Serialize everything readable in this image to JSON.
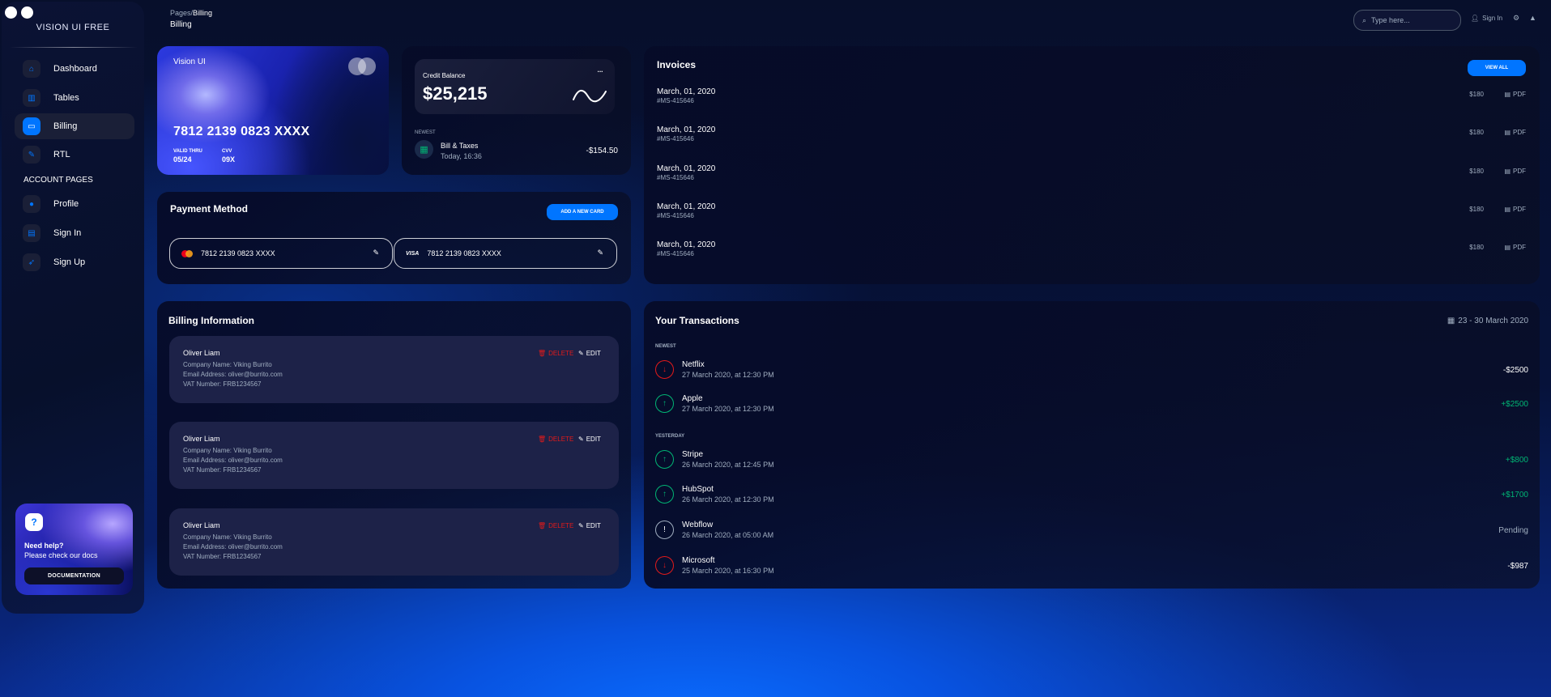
{
  "brand": "VISION UI FREE",
  "nav": [
    {
      "label": "Dashboard",
      "icon": "home-icon"
    },
    {
      "label": "Tables",
      "icon": "chart-icon"
    },
    {
      "label": "Billing",
      "icon": "credit-card-icon"
    },
    {
      "label": "RTL",
      "icon": "wrench-icon"
    }
  ],
  "account_section": "ACCOUNT PAGES",
  "account_nav": [
    {
      "label": "Profile",
      "icon": "person-icon"
    },
    {
      "label": "Sign In",
      "icon": "document-icon"
    },
    {
      "label": "Sign Up",
      "icon": "rocket-icon"
    }
  ],
  "help": {
    "title": "Need help?",
    "subtitle": "Please check our docs",
    "button": "DOCUMENTATION"
  },
  "header": {
    "breadcrumb_root": "Pages",
    "breadcrumb_sep": "/",
    "breadcrumb_current": "Billing",
    "title": "Billing",
    "search_placeholder": "Type here...",
    "signin": "Sign In"
  },
  "visa_card": {
    "brand": "Vision UI",
    "number": "7812 2139 0823 XXXX",
    "valid_label": "VALID THRU",
    "valid_value": "05/24",
    "cvv_label": "CVV",
    "cvv_value": "09X"
  },
  "credit": {
    "label": "Credit Balance",
    "amount": "$25,215",
    "more": "...",
    "newest_label": "NEWEST",
    "item_title": "Bill & Taxes",
    "item_time": "Today, 16:36",
    "item_amount": "-$154.50"
  },
  "payment": {
    "title": "Payment Method",
    "add_button": "ADD A NEW CARD",
    "cards": [
      {
        "number": "7812 2139 0823 XXXX"
      },
      {
        "brand": "VISA",
        "number": "7812 2139 0823 XXXX"
      }
    ]
  },
  "invoices": {
    "title": "Invoices",
    "view_all": "VIEW ALL",
    "rows": [
      {
        "date": "March, 01, 2020",
        "id": "#MS-415646",
        "price": "$180",
        "pdf": "PDF"
      },
      {
        "date": "March, 01, 2020",
        "id": "#MS-415646",
        "price": "$180",
        "pdf": "PDF"
      },
      {
        "date": "March, 01, 2020",
        "id": "#MS-415646",
        "price": "$180",
        "pdf": "PDF"
      },
      {
        "date": "March, 01, 2020",
        "id": "#MS-415646",
        "price": "$180",
        "pdf": "PDF"
      },
      {
        "date": "March, 01, 2020",
        "id": "#MS-415646",
        "price": "$180",
        "pdf": "PDF"
      }
    ]
  },
  "billing_info": {
    "title": "Billing Information",
    "delete_label": "DELETE",
    "edit_label": "EDIT",
    "items": [
      {
        "name": "Oliver Liam",
        "company": "Company Name: Viking Burrito",
        "email": "Email Address: oliver@burrito.com",
        "vat": "VAT Number: FRB1234567"
      },
      {
        "name": "Oliver Liam",
        "company": "Company Name: Viking Burrito",
        "email": "Email Address: oliver@burrito.com",
        "vat": "VAT Number: FRB1234567"
      },
      {
        "name": "Oliver Liam",
        "company": "Company Name: Viking Burrito",
        "email": "Email Address: oliver@burrito.com",
        "vat": "VAT Number: FRB1234567"
      }
    ]
  },
  "transactions": {
    "title": "Your Transactions",
    "range": "23 - 30 March 2020",
    "newest_label": "NEWEST",
    "yesterday_label": "YESTERDAY",
    "items": [
      {
        "name": "Netflix",
        "time": "27 March 2020, at 12:30 PM",
        "amount": "-$2500",
        "status": "negative"
      },
      {
        "name": "Apple",
        "time": "27 March 2020, at 12:30 PM",
        "amount": "+$2500",
        "status": "positive"
      },
      {
        "name": "Stripe",
        "time": "26 March 2020, at 12:45 PM",
        "amount": "+$800",
        "status": "positive"
      },
      {
        "name": "HubSpot",
        "time": "26 March 2020, at 12:30 PM",
        "amount": "+$1700",
        "status": "positive"
      },
      {
        "name": "Webflow",
        "time": "26 March 2020, at 05:00 AM",
        "amount": "Pending",
        "status": "pending"
      },
      {
        "name": "Microsoft",
        "time": "25 March 2020, at 16:30 PM",
        "amount": "-$987",
        "status": "negative"
      }
    ]
  },
  "colors": {
    "accent": "#0075ff",
    "positive": "#01b574",
    "negative": "#e31a1a",
    "muted": "#a0aec0"
  }
}
